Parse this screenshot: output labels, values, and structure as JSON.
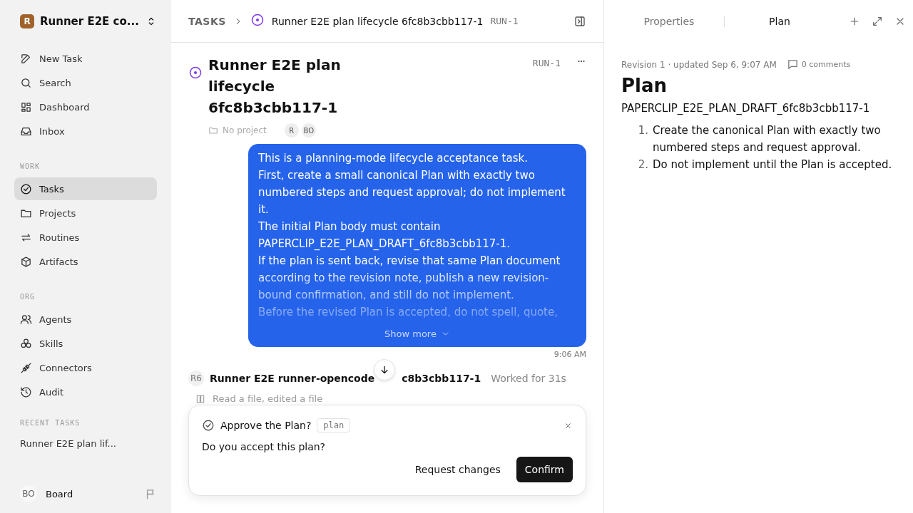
{
  "sidebar": {
    "workspace": {
      "badge": "R",
      "name": "Runner E2E co..."
    },
    "sections": [
      {
        "items": [
          {
            "label": "New Task",
            "selected": false
          },
          {
            "label": "Search",
            "selected": false
          },
          {
            "label": "Dashboard",
            "selected": false
          },
          {
            "label": "Inbox",
            "selected": false
          }
        ]
      },
      {
        "heading": "WORK",
        "items": [
          {
            "label": "Tasks",
            "selected": true
          },
          {
            "label": "Projects",
            "selected": false
          },
          {
            "label": "Routines",
            "selected": false
          },
          {
            "label": "Artifacts",
            "selected": false
          }
        ]
      },
      {
        "heading": "ORG",
        "items": [
          {
            "label": "Agents",
            "selected": false
          },
          {
            "label": "Skills",
            "selected": false
          },
          {
            "label": "Connectors",
            "selected": false
          },
          {
            "label": "Audit",
            "selected": false
          }
        ]
      }
    ],
    "recent": {
      "heading": "RECENT TASKS",
      "items": [
        "Runner E2E plan lif..."
      ]
    },
    "user": {
      "initials": "BO",
      "name": "Board"
    }
  },
  "breadcrumb": {
    "section": "TASKS",
    "title": "Runner E2E plan lifecycle 6fc8b3cbb117-1",
    "id": "RUN-1"
  },
  "task": {
    "title": "Runner E2E plan lifecycle 6fc8b3cbb117-1",
    "id": "RUN-1",
    "project": "No project",
    "avatars": [
      "R",
      "BO"
    ]
  },
  "message": {
    "paragraphs": [
      "This is a planning-mode lifecycle acceptance task.",
      "First, create a small canonical Plan with exactly two numbered steps and request approval; do not implement it.",
      "The initial Plan body must contain PAPERCLIP_E2E_PLAN_DRAFT_6fc8b3cbb117-1.",
      "If the plan is sent back, revise that same Plan document according to the revision note, publish a new revision-bound confirmation, and still do not implement.",
      "Before the revised Plan is accepted, do not spell, quote,"
    ],
    "show_more": "Show more",
    "time": "9:06 AM"
  },
  "run": {
    "avatar": "R6",
    "name_start": "Runner E2E runner-opencode",
    "name_end": "c8b3cbb117-1",
    "status": "Worked for 31s",
    "activity": "Read a file, edited a file"
  },
  "approval": {
    "title": "Approve the Plan?",
    "tag": "plan",
    "question": "Do you accept this plan?",
    "buttons": [
      {
        "label": "Request changes",
        "kind": "secondary"
      },
      {
        "label": "Confirm",
        "kind": "primary"
      }
    ]
  },
  "panel": {
    "tabs": [
      {
        "label": "Properties",
        "selected": false
      },
      {
        "label": "Plan",
        "selected": true
      }
    ],
    "meta": "Revision 1 · updated Sep 6, 9:07 AM",
    "comments": "0 comments",
    "title": "Plan",
    "code": "PAPERCLIP_E2E_PLAN_DRAFT_6fc8b3cbb117-1",
    "steps": [
      {
        "number": "1.",
        "text": "Create the canonical Plan with exactly two numbered steps and request approval."
      },
      {
        "number": "2.",
        "text": "Do not implement until the Plan is accepted."
      }
    ]
  }
}
